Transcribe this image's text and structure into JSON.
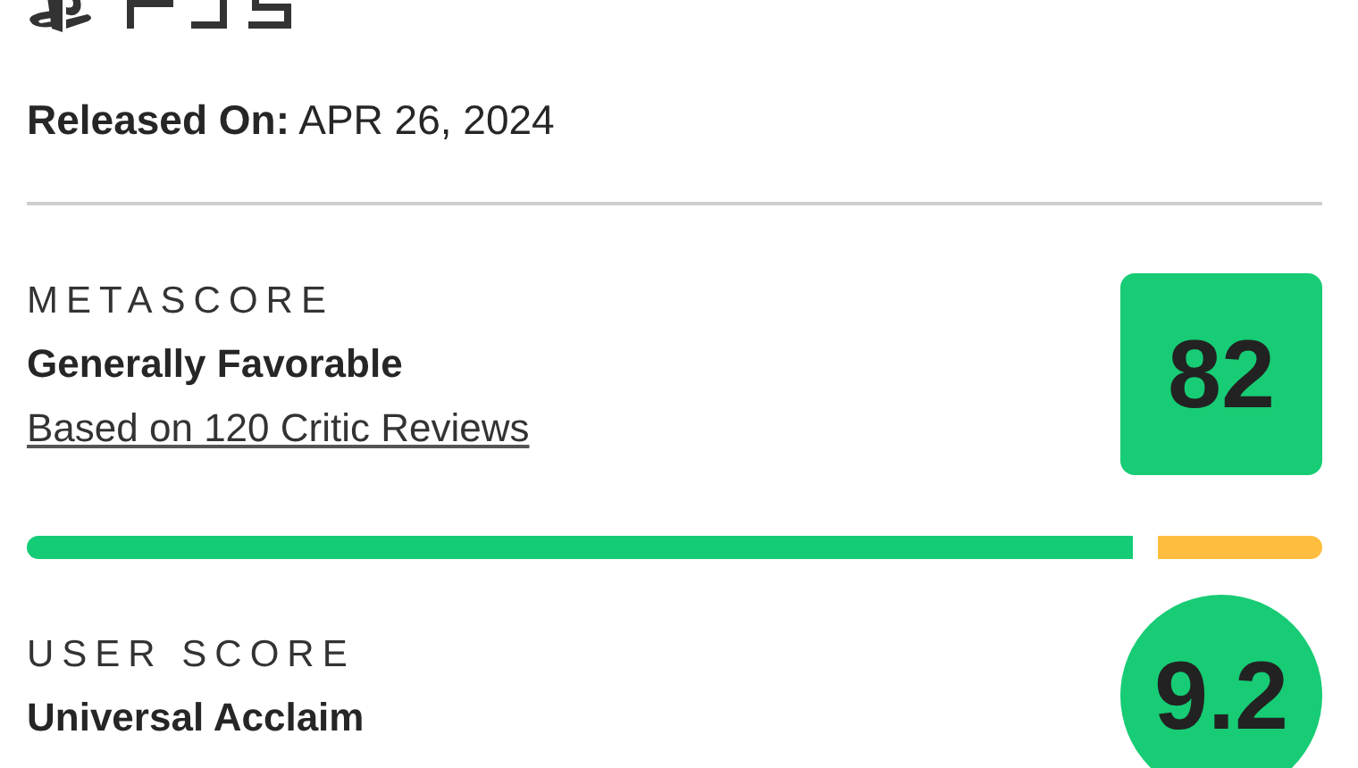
{
  "released": {
    "label": "Released On:",
    "date": "APR 26, 2024"
  },
  "metascore": {
    "heading": "METASCORE",
    "verdict": "Generally Favorable",
    "reviews_link": "Based on 120 Critic Reviews",
    "score": "82",
    "color": "#17cc74",
    "distribution": [
      {
        "color": "#14cc76",
        "level": 0.855
      },
      {
        "color": "#ffbd3f",
        "level": 0.127
      }
    ]
  },
  "user_score": {
    "heading": "USER SCORE",
    "verdict": "Universal Acclaim",
    "score": "9.2",
    "color": "#17cc74"
  }
}
